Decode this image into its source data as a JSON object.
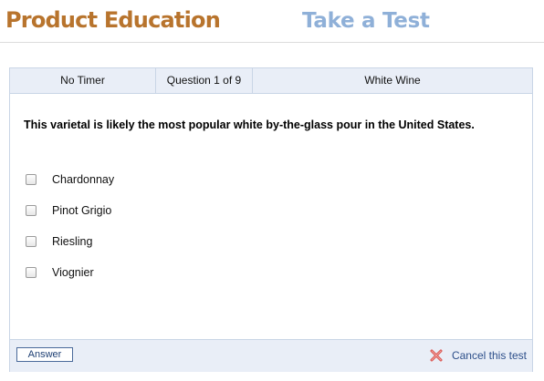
{
  "header": {
    "brand": "Product Education",
    "section": "Take a Test"
  },
  "info_bar": {
    "timer": "No Timer",
    "progress": "Question 1 of 9",
    "topic": "White Wine"
  },
  "question": {
    "text": "This varietal is likely the most popular white by-the-glass pour in the United States.",
    "options": [
      {
        "label": "Chardonnay",
        "checked": false
      },
      {
        "label": "Pinot Grigio",
        "checked": false
      },
      {
        "label": "Riesling",
        "checked": false
      },
      {
        "label": "Viognier",
        "checked": false
      }
    ]
  },
  "footer": {
    "answer_label": "Answer",
    "cancel_label": "Cancel this test",
    "cancel_icon": "close-x-icon"
  },
  "colors": {
    "brand": "#b8742d",
    "section_title": "#8fb0d8",
    "bar_background": "#e9eef7",
    "link": "#2d4f8a",
    "cancel_icon": "#d9534f"
  }
}
